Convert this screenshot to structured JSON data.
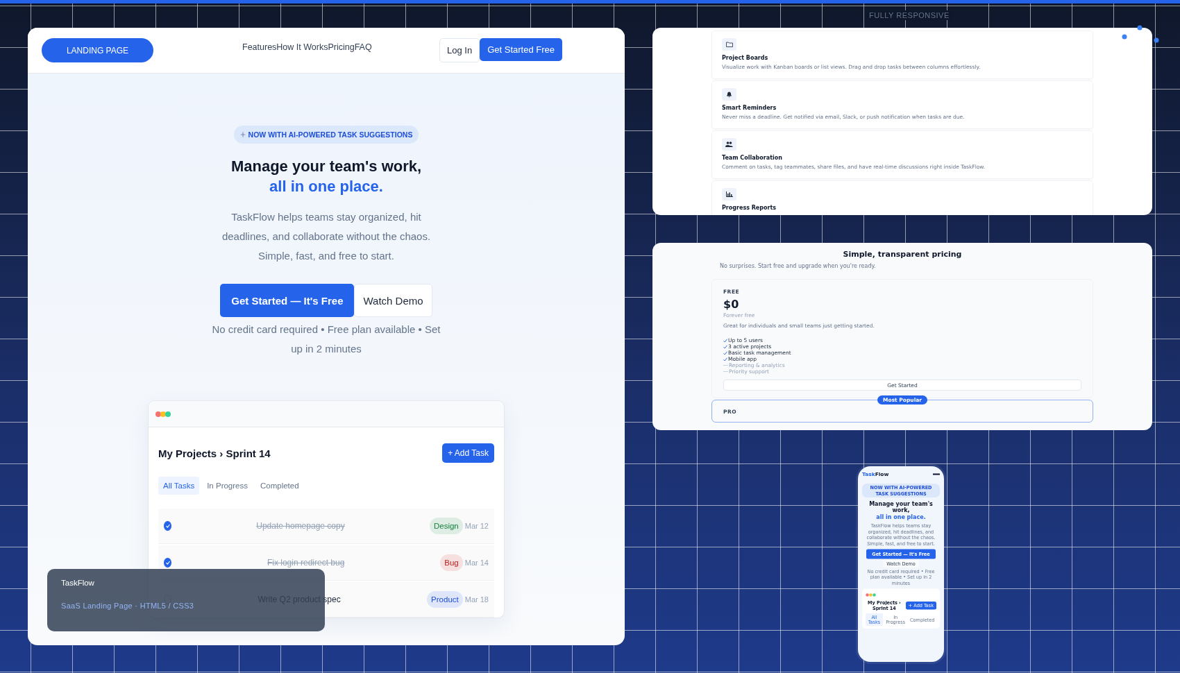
{
  "showcase_label": "FULLY RESPONSIVE",
  "desktop": {
    "nav": {
      "logo": "LANDING PAGE",
      "links": [
        "Features",
        "How It Works",
        "Pricing",
        "FAQ"
      ],
      "login": "Log In",
      "cta": "Get Started Free"
    },
    "hero": {
      "badge": "NOW WITH AI-POWERED TASK SUGGESTIONS",
      "title": "Manage your team's work,",
      "title_accent": "all in one place.",
      "text": "TaskFlow helps teams stay organized, hit deadlines, and collaborate without the chaos. Simple, fast, and free to start.",
      "primary": "Get Started — It's Free",
      "secondary": "Watch Demo",
      "note": "No credit card required • Free plan available • Set up in 2 minutes"
    },
    "app": {
      "title": "My Projects › Sprint 14",
      "add": "+ Add Task",
      "tabs": [
        {
          "label": "All Tasks",
          "selected": true
        },
        {
          "label": "In Progress",
          "selected": false
        },
        {
          "label": "Completed",
          "selected": false
        }
      ],
      "tasks": [
        {
          "title": "Update homepage copy",
          "done": true,
          "tag": "Design",
          "color": "#15803d",
          "date": "Mar 12"
        },
        {
          "title": "Fix login redirect bug",
          "done": true,
          "tag": "Bug",
          "color": "#b91c1c",
          "date": "Mar 14"
        },
        {
          "title": "Write Q2 product spec",
          "done": false,
          "tag": "Product",
          "color": "#1d4ed8",
          "date": "Mar 18"
        }
      ]
    }
  },
  "caption": {
    "title": "TaskFlow",
    "subtitle": "SaaS Landing Page · HTML5 / CSS3"
  },
  "features": [
    {
      "title": "Project Boards",
      "text": "Visualize work with Kanban boards or list views. Drag and drop tasks between columns effortlessly."
    },
    {
      "title": "Smart Reminders",
      "text": "Never miss a deadline. Get notified via email, Slack, or push notification when tasks are due."
    },
    {
      "title": "Team Collaboration",
      "text": "Comment on tasks, tag teammates, share files, and have real-time discussions right inside TaskFlow."
    },
    {
      "title": "Progress Reports"
    }
  ],
  "pricing": {
    "title": "Simple, transparent pricing",
    "subtitle": "No surprises. Start free and upgrade when you're ready.",
    "plans": [
      {
        "name": "FREE",
        "price": "$0",
        "period": "Forever free",
        "text": "Great for individuals and small teams just getting started.",
        "button": "Get Started",
        "features": [
          {
            "label": "Up to 5 users",
            "included": true
          },
          {
            "label": "3 active projects",
            "included": true
          },
          {
            "label": "Basic task management",
            "included": true
          },
          {
            "label": "Mobile app",
            "included": true
          },
          {
            "label": "Reporting & analytics",
            "included": false
          },
          {
            "label": "Priority support",
            "included": false
          }
        ]
      },
      {
        "name": "PRO",
        "badge": "Most Popular"
      }
    ]
  },
  "mobile": {
    "logo": [
      {
        "text": "Task",
        "accent": true
      },
      {
        "text": "Flow",
        "accent": false
      }
    ],
    "badge": "NOW WITH AI-POWERED TASK SUGGESTIONS",
    "title": "Manage your team's work,",
    "title_accent": "all in one place.",
    "text": "TaskFlow helps teams stay organized, hit deadlines, and collaborate without the chaos. Simple, fast, and free to start.",
    "primary": "Get Started — It's Free",
    "secondary": "Watch Demo",
    "note": "No credit card required • Free plan available • Set up in 2 minutes",
    "app_title": "My Projects › Sprint 14",
    "add": "+ Add Task",
    "tabs": [
      {
        "label": "All Tasks",
        "selected": true
      },
      {
        "label": "In Progress",
        "selected": false
      },
      {
        "label": "Completed",
        "selected": false
      }
    ]
  }
}
